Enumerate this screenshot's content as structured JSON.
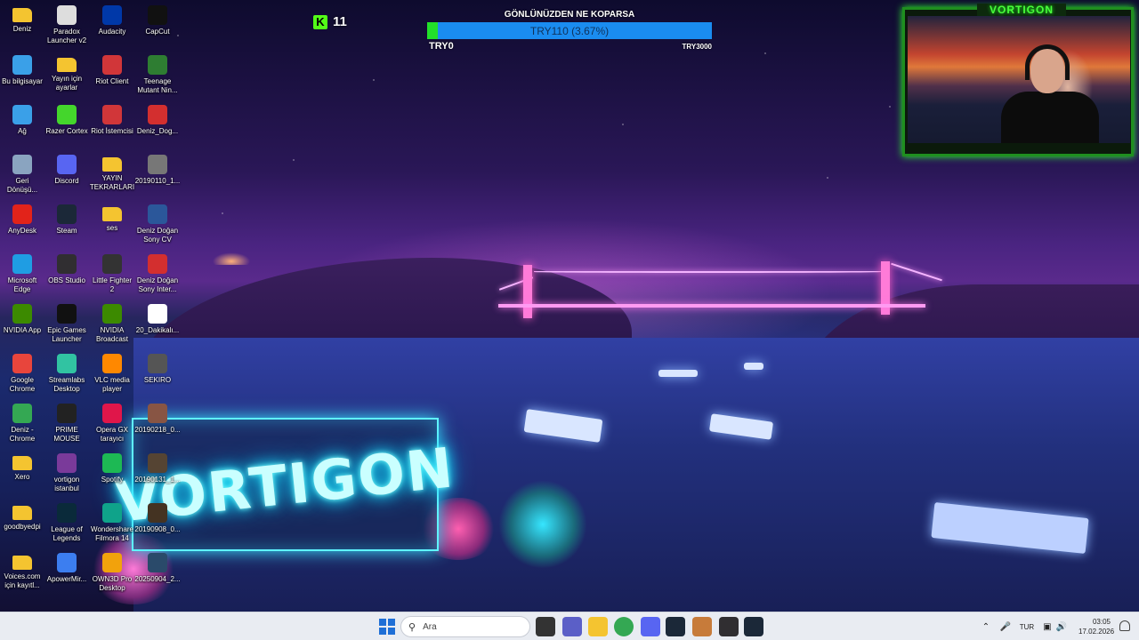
{
  "desktop_icons": [
    {
      "id": "deniz",
      "label": "Deniz",
      "icon": "folder-icon",
      "color": "#f4c430"
    },
    {
      "id": "bu-bilgisayar",
      "label": "Bu bilgisayar",
      "icon": "computer-icon",
      "color": "#3aa0e8"
    },
    {
      "id": "ag",
      "label": "Ağ",
      "icon": "network-icon",
      "color": "#3aa0e8"
    },
    {
      "id": "geri-donusum",
      "label": "Geri\nDönüşü...",
      "icon": "recycle-bin-icon",
      "color": "#8aa4c0"
    },
    {
      "id": "anydesk",
      "label": "AnyDesk",
      "icon": "anydesk-icon",
      "color": "#e2231a"
    },
    {
      "id": "microsoft-edge",
      "label": "Microsoft\nEdge",
      "icon": "edge-icon",
      "color": "#1f9de3"
    },
    {
      "id": "nvidia-app",
      "label": "NVIDIA App",
      "icon": "nvidia-icon",
      "color": "#3c8a00"
    },
    {
      "id": "google-chrome",
      "label": "Google\nChrome",
      "icon": "chrome-icon",
      "color": "#e8453c"
    },
    {
      "id": "deniz-chrome",
      "label": "Deniz -\nChrome",
      "icon": "chrome-icon",
      "color": "#34a853"
    },
    {
      "id": "xero",
      "label": "Xero",
      "icon": "folder-icon",
      "color": "#f4c430"
    },
    {
      "id": "goodbyedpi",
      "label": "goodbyedpi",
      "icon": "folder-icon",
      "color": "#f4c430"
    },
    {
      "id": "voices-com",
      "label": "Voices.com\niçin kayıtl...",
      "icon": "folder-icon",
      "color": "#f4c430"
    },
    {
      "id": "paradox-launcher",
      "label": "Paradox\nLauncher v2",
      "icon": "paradox-icon",
      "color": "#dddddd"
    },
    {
      "id": "yayin-icin-ayarlar",
      "label": "Yayın için\nayarlar",
      "icon": "folder-icon",
      "color": "#f4c430"
    },
    {
      "id": "razer-cortex",
      "label": "Razer Cortex",
      "icon": "razer-icon",
      "color": "#44d62c"
    },
    {
      "id": "discord",
      "label": "Discord",
      "icon": "discord-icon",
      "color": "#5865f2"
    },
    {
      "id": "steam",
      "label": "Steam",
      "icon": "steam-icon",
      "color": "#1b2838"
    },
    {
      "id": "obs-studio",
      "label": "OBS Studio",
      "icon": "obs-icon",
      "color": "#302e31"
    },
    {
      "id": "epic-games",
      "label": "Epic Games\nLauncher",
      "icon": "epic-icon",
      "color": "#111111"
    },
    {
      "id": "streamlabs",
      "label": "Streamlabs\nDesktop",
      "icon": "streamlabs-icon",
      "color": "#31c3a2"
    },
    {
      "id": "prime-mouse",
      "label": "PRIME\nMOUSE",
      "icon": "mouse-icon",
      "color": "#222222"
    },
    {
      "id": "vortigon-istanbul",
      "label": "vortigon\nistanbul",
      "icon": "image-icon",
      "color": "#7a3a9a"
    },
    {
      "id": "league-of-legends",
      "label": "League of\nLegends",
      "icon": "league-icon",
      "color": "#0a2a3a"
    },
    {
      "id": "apowermirror",
      "label": "ApowerMir...",
      "icon": "apowermirror-icon",
      "color": "#3c7ef0"
    },
    {
      "id": "audacity",
      "label": "Audacity",
      "icon": "audacity-icon",
      "color": "#0038a8"
    },
    {
      "id": "riot-client",
      "label": "Riot Client",
      "icon": "riot-icon",
      "color": "#d13639"
    },
    {
      "id": "riot-istemcisi",
      "label": "Riot İstemcisi",
      "icon": "riot-icon",
      "color": "#d13639"
    },
    {
      "id": "yayin-tekrarlari",
      "label": "YAYIN\nTEKRARLARI",
      "icon": "folder-icon",
      "color": "#f4c430"
    },
    {
      "id": "ses",
      "label": "ses",
      "icon": "folder-icon",
      "color": "#f4c430"
    },
    {
      "id": "little-fighter",
      "label": "Little Fighter\n2",
      "icon": "little-fighter-icon",
      "color": "#333333"
    },
    {
      "id": "nvidia-broadcast",
      "label": "NVIDIA\nBroadcast",
      "icon": "nvidia-icon",
      "color": "#3c8a00"
    },
    {
      "id": "vlc",
      "label": "VLC media\nplayer",
      "icon": "vlc-icon",
      "color": "#ff8800"
    },
    {
      "id": "opera-gx",
      "label": "Opera GX\ntarayıcı",
      "icon": "opera-gx-icon",
      "color": "#e0164a"
    },
    {
      "id": "spotify",
      "label": "Spotify",
      "icon": "spotify-icon",
      "color": "#1db954"
    },
    {
      "id": "wondershare-filmora",
      "label": "Wondershare\nFilmora 14",
      "icon": "filmora-icon",
      "color": "#0fa38a"
    },
    {
      "id": "own3d-pro",
      "label": "OWN3D Pro\nDesktop",
      "icon": "own3d-icon",
      "color": "#f2a20c"
    },
    {
      "id": "capcut",
      "label": "CapCut",
      "icon": "capcut-icon",
      "color": "#111111"
    },
    {
      "id": "teenage-mutant",
      "label": "Teenage\nMutant Nin...",
      "icon": "game-icon",
      "color": "#2e7d32"
    },
    {
      "id": "deniz-dog-pdf",
      "label": "Deniz_Dog...",
      "icon": "pdf-icon",
      "color": "#d32f2f"
    },
    {
      "id": "file-20190110",
      "label": "20190110_1...",
      "icon": "image-icon",
      "color": "#777777"
    },
    {
      "id": "deniz-dogan-cv",
      "label": "Deniz Doğan\nSony CV",
      "icon": "word-icon",
      "color": "#2b579a"
    },
    {
      "id": "deniz-dogan-sony-inter",
      "label": "Deniz Doğan\nSony Inter...",
      "icon": "pdf-icon",
      "color": "#d32f2f"
    },
    {
      "id": "20-dakikali",
      "label": "20_Dakikalı...",
      "icon": "document-icon",
      "color": "#ffffff"
    },
    {
      "id": "sekiro",
      "label": "SEKIRO",
      "icon": "sekiro-icon",
      "color": "#555555"
    },
    {
      "id": "file-20190218",
      "label": "20190218_0...",
      "icon": "image-icon",
      "color": "#885544"
    },
    {
      "id": "file-20190131",
      "label": "20190131_1...",
      "icon": "image-icon",
      "color": "#554433"
    },
    {
      "id": "file-20190908",
      "label": "20190908_0...",
      "icon": "image-icon",
      "color": "#443322"
    },
    {
      "id": "file-20250904",
      "label": "20250904_2...",
      "icon": "image-icon",
      "color": "#2a4a6a"
    }
  ],
  "overlays": {
    "kick_followers": "11",
    "goal": {
      "title": "GÖNLÜNÜZDEN NE KOPARSA",
      "value_text": "TRY110 (3.67%)",
      "progress_percent": 3.67,
      "min_label": "TRY0",
      "max_label": "TRY3000"
    },
    "webcam_brand": "VORTIGON"
  },
  "wallpaper": {
    "sign_text": "VORTIGON"
  },
  "taskbar": {
    "search_placeholder": "Ara",
    "language": "TUR",
    "time": "03:05",
    "date": "17.02.2026",
    "pinned": [
      {
        "id": "start",
        "icon": "windows-start-icon",
        "color": "#1f6fd6"
      },
      {
        "id": "task-view",
        "icon": "task-view-icon",
        "color": "#333333"
      },
      {
        "id": "teams",
        "icon": "teams-icon",
        "color": "#5b5fc7"
      },
      {
        "id": "file-explorer",
        "icon": "file-explorer-icon",
        "color": "#f4c430"
      },
      {
        "id": "chrome",
        "icon": "chrome-icon",
        "color": "#34a853"
      },
      {
        "id": "discord",
        "icon": "discord-icon",
        "color": "#5865f2"
      },
      {
        "id": "steam",
        "icon": "steam-icon",
        "color": "#1b2838"
      },
      {
        "id": "app-orange",
        "icon": "app-icon",
        "color": "#c77b3a"
      },
      {
        "id": "obs",
        "icon": "obs-icon",
        "color": "#302e31"
      },
      {
        "id": "steam-2",
        "icon": "steam-icon",
        "color": "#1b2838"
      }
    ]
  }
}
